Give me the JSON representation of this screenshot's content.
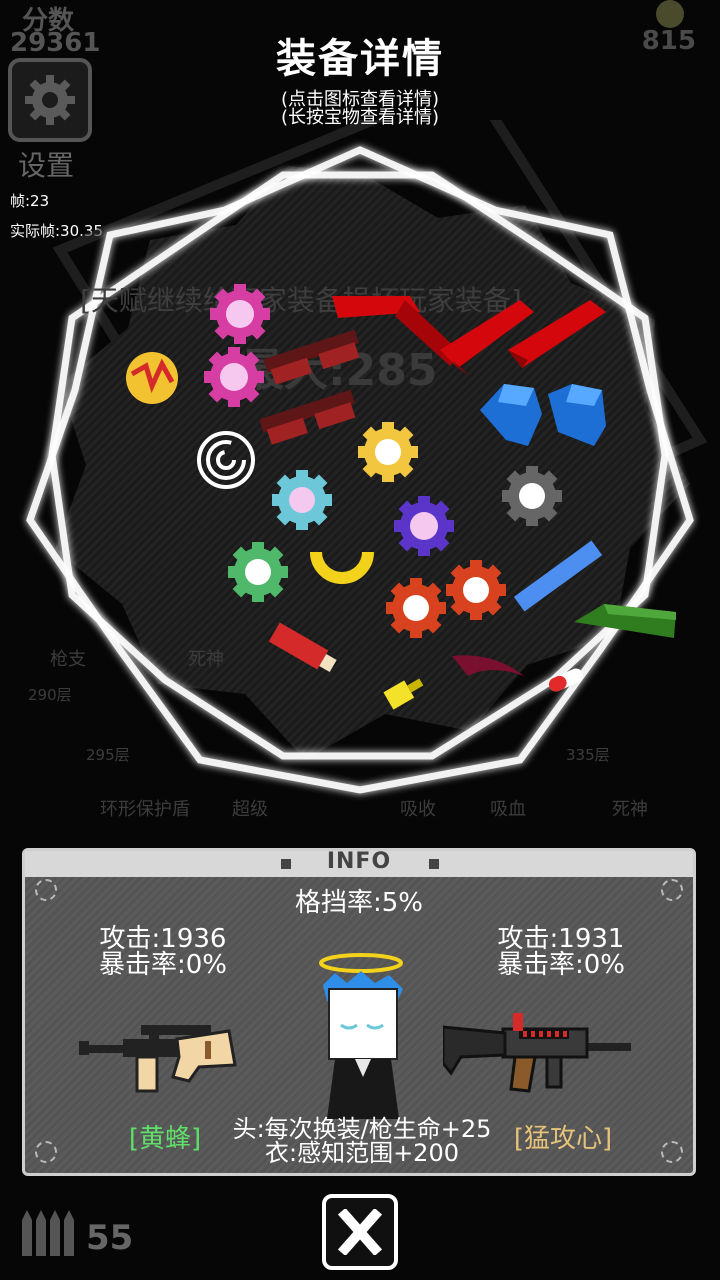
{
  "hud": {
    "score_label": "分数",
    "score_value": "29361",
    "coin_value": "815",
    "settings_label": "设置",
    "fps": "帧:23",
    "real_fps": "实际帧:30.35",
    "ammo_count": "55"
  },
  "dialog": {
    "title": "装备详情",
    "hint_icon": "(点击图标查看详情)",
    "hint_treasure": "(长按宝物查看详情)"
  },
  "background": {
    "banner": "[天赋继续给玩家装备损坏玩家装备]",
    "max_label": "最大:285",
    "labels": [
      "枪支",
      "死神",
      "290层",
      "295层",
      "335层",
      "环形保护盾",
      "超级",
      "吸收",
      "吸血",
      "死神"
    ]
  },
  "panel": {
    "title": "INFO",
    "block_rate": "格挡率:5%",
    "left": {
      "attack": "攻击:1936",
      "crit": "暴击率:0%",
      "name": "[黄蜂]",
      "name_color": "#5fe06a"
    },
    "right": {
      "attack": "攻击:1931",
      "crit": "暴击率:0%",
      "name": "[猛攻心]",
      "name_color": "#e7c37a"
    },
    "bonus_head": "头:每次换装/枪生命+25",
    "bonus_body": "衣:感知范围+200"
  },
  "icons": {
    "settings": "gear-icon",
    "close": "close-x-icon",
    "ammo": "bullets-icon",
    "left_weapon": "sniper-rifle-icon",
    "right_weapon": "assault-rifle-icon",
    "character": "angel-character"
  },
  "treasures": [
    {
      "name": "pink-gear-treasure",
      "color": "#d63ea3"
    },
    {
      "name": "pink-gear-treasure",
      "color": "#d63ea3"
    },
    {
      "name": "yellow-lightning-orb-treasure",
      "color": "#f2c230"
    },
    {
      "name": "red-glasses-treasure",
      "color": "#8e1d1d"
    },
    {
      "name": "red-glasses-treasure",
      "color": "#8e1d1d"
    },
    {
      "name": "red-bracket-treasure",
      "color": "#d4080c"
    },
    {
      "name": "red-bracket-treasure",
      "color": "#d4080c"
    },
    {
      "name": "red-bracket-treasure",
      "color": "#d4080c"
    },
    {
      "name": "blue-boots-treasure",
      "color": "#1d6fd6"
    },
    {
      "name": "blue-boots-treasure",
      "color": "#1d6fd6"
    },
    {
      "name": "white-spiral-treasure",
      "color": "#ffffff"
    },
    {
      "name": "yellow-gear-treasure",
      "color": "#f3c640"
    },
    {
      "name": "cyan-gear-treasure",
      "color": "#6cc7d8"
    },
    {
      "name": "grey-gear-treasure",
      "color": "#666666"
    },
    {
      "name": "purple-gear-treasure",
      "color": "#5b35c9"
    },
    {
      "name": "green-gear-treasure",
      "color": "#4fb86a"
    },
    {
      "name": "yellow-horseshoe-treasure",
      "color": "#f2d21b"
    },
    {
      "name": "orange-gear-treasure",
      "color": "#d9421f"
    },
    {
      "name": "orange-gear-treasure",
      "color": "#d9421f"
    },
    {
      "name": "blue-bar-treasure",
      "color": "#4c8ff0"
    },
    {
      "name": "green-blade-treasure",
      "color": "#2f7d1f"
    },
    {
      "name": "red-tube-treasure",
      "color": "#d42a2a"
    },
    {
      "name": "dark-red-horn-treasure",
      "color": "#7a1030"
    },
    {
      "name": "yellow-arrow-treasure",
      "color": "#f3e12a"
    },
    {
      "name": "pill-treasure",
      "color": "#ffffff"
    }
  ]
}
